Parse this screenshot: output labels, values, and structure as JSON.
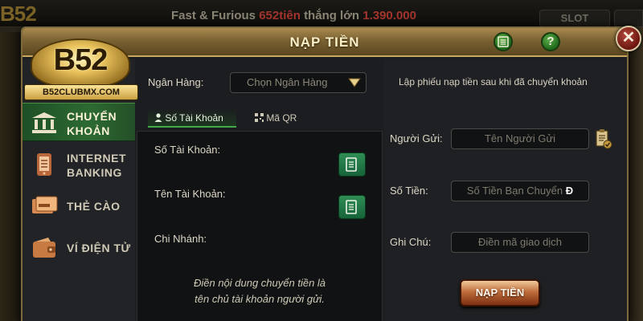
{
  "background": {
    "ticker_prefix": "Fast & Furious",
    "ticker_amount": "652tiên",
    "ticker_mid": "thắng lớn",
    "ticker_value": "1.390.000",
    "logo_text": "B52",
    "slot_tab": "SLOT"
  },
  "modal": {
    "title": "NẠP TIỀN",
    "help_label": "?",
    "close_label": "✕"
  },
  "logo": {
    "main": "B52",
    "ribbon": "B52CLUBMX.COM"
  },
  "sidebar": {
    "items": [
      {
        "label": "CHUYỂN KHOẢN",
        "icon": "bank-icon",
        "active": true
      },
      {
        "label": "INTERNET BANKING",
        "icon": "phone-banking-icon",
        "active": false
      },
      {
        "label": "THẺ CÀO",
        "icon": "scratch-card-icon",
        "active": false
      },
      {
        "label": "VÍ ĐIỆN TỬ",
        "icon": "wallet-icon",
        "active": false
      }
    ]
  },
  "transfer": {
    "bank_label": "Ngân Hàng:",
    "bank_placeholder": "Chọn Ngân Hàng",
    "tabs": [
      {
        "label": "Số Tài Khoản",
        "icon": "user-icon",
        "active": true
      },
      {
        "label": "Mã QR",
        "icon": "qr-icon",
        "active": false
      }
    ],
    "account_number_label": "Số Tài Khoản:",
    "account_name_label": "Tên Tài Khoản:",
    "branch_label": "Chi Nhánh:",
    "note_line1": "Điền nội dung chuyển tiền là",
    "note_line2": "tên chủ tài khoản người gửi."
  },
  "form": {
    "title": "Lập phiếu nạp tiền sau khi đã chuyển khoản",
    "sender_label": "Người Gửi:",
    "sender_placeholder": "Tên Người Gửi",
    "amount_label": "Số Tiền:",
    "amount_placeholder": "Số Tiền Bạn Chuyển",
    "currency_symbol": "Đ",
    "note_label": "Ghi Chú:",
    "note_placeholder": "Điền mã giao dịch",
    "submit_label": "NẠP TIỀN"
  },
  "colors": {
    "accent_gold": "#a8894f",
    "active_green": "#2d6a32",
    "close_red": "#b2473a",
    "submit_brown": "#bf6e3c"
  }
}
